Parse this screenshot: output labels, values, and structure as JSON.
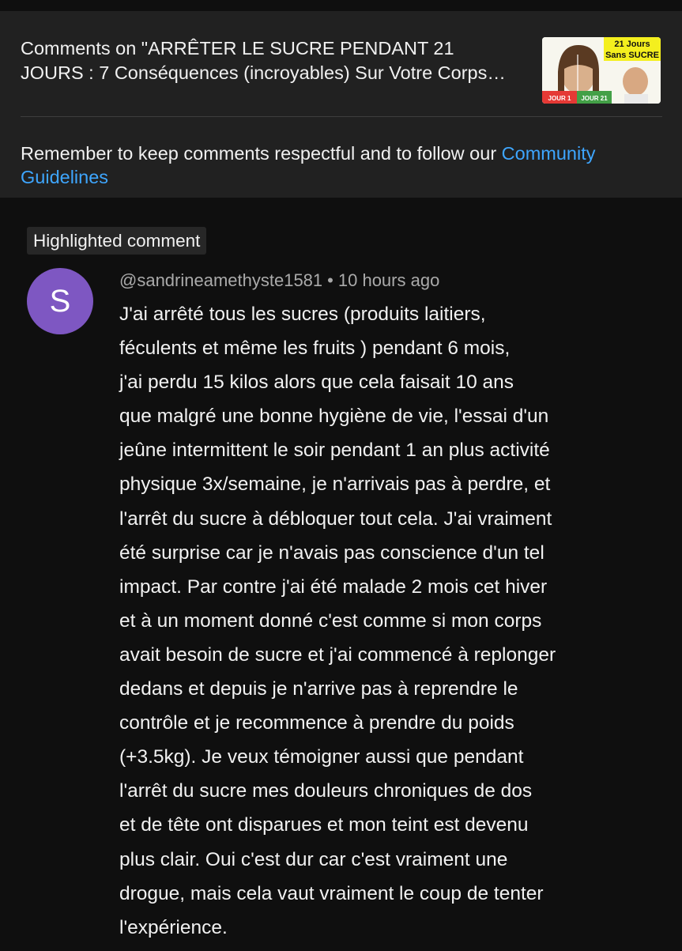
{
  "header": {
    "title_line1": "Comments on \"ARRÊTER LE SUCRE PENDANT 21",
    "title_line2": "JOURS : 7 Conséquences (incroyables) Sur Votre Corps…",
    "thumbnail": {
      "badge_line1": "21 Jours",
      "badge_line2": "Sans SUCRE",
      "tag_left": "JOUR 1",
      "tag_right": "JOUR 21"
    },
    "guidelines_text": "Remember to keep comments respectful and to follow our ",
    "guidelines_link_part1": "Community",
    "guidelines_link_part2": "Guidelines"
  },
  "comment": {
    "badge": "Highlighted comment",
    "avatar_letter": "S",
    "author": "@sandrineamethyste1581",
    "separator": "•",
    "time": "10 hours ago",
    "lines": [
      "J'ai arrêté tous les sucres (produits laitiers,",
      "féculents et même les fruits ) pendant 6 mois,",
      "j'ai perdu 15 kilos alors que cela faisait 10 ans",
      "que malgré une bonne hygiène de vie, l'essai d'un",
      "jeûne intermittent le soir pendant 1 an plus activité",
      "physique 3x/semaine, je n'arrivais pas à perdre, et",
      "l'arrêt du sucre à débloquer tout cela. J'ai vraiment",
      "été surprise car je n'avais pas conscience d'un tel",
      "impact. Par contre j'ai été malade 2 mois cet hiver",
      "et à un moment donné c'est comme si mon corps",
      "avait besoin de sucre et j'ai commencé à replonger",
      "dedans et depuis je n'arrive pas à reprendre le",
      "contrôle et je recommence à prendre du poids",
      "(+3.5kg). Je veux témoigner aussi que pendant",
      "l'arrêt du sucre mes douleurs chroniques de dos",
      "et de tête ont disparues et mon teint est devenu",
      "plus clair. Oui c'est dur car c'est vraiment une",
      "drogue, mais cela vaut vraiment le coup de tenter",
      "l'expérience."
    ]
  },
  "colors": {
    "background": "#0f0f0f",
    "header_background": "#212121",
    "link": "#3ea6ff",
    "avatar": "#7e57c2",
    "secondary_text": "#aaaaaa"
  }
}
